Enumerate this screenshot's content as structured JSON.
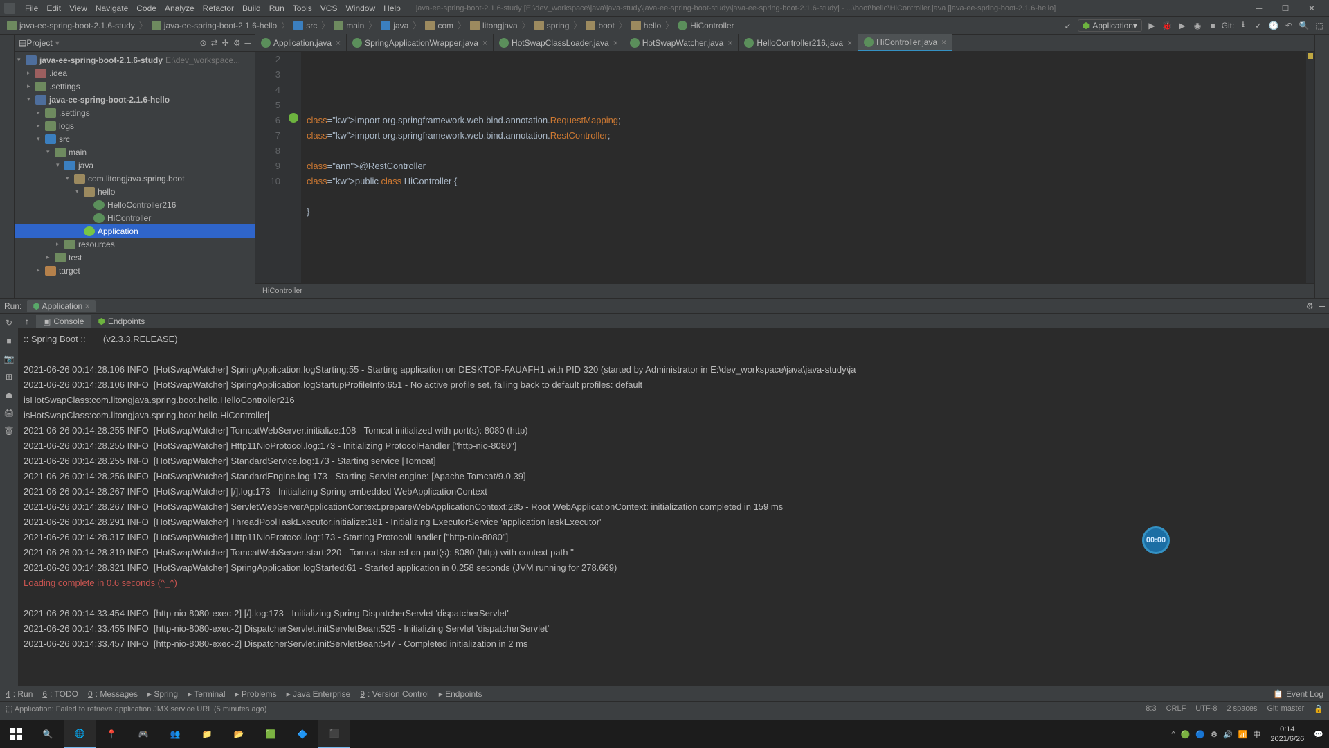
{
  "menu": [
    "File",
    "Edit",
    "View",
    "Navigate",
    "Code",
    "Analyze",
    "Refactor",
    "Build",
    "Run",
    "Tools",
    "VCS",
    "Window",
    "Help"
  ],
  "title": "java-ee-spring-boot-2.1.6-study [E:\\dev_workspace\\java\\java-study\\java-ee-spring-boot-study\\java-ee-spring-boot-2.1.6-study] - ...\\boot\\hello\\HiController.java [java-ee-spring-boot-2.1.6-hello]",
  "breadcrumbs": [
    {
      "t": "java-ee-spring-boot-2.1.6-study",
      "k": "module"
    },
    {
      "t": "java-ee-spring-boot-2.1.6-hello",
      "k": "module"
    },
    {
      "t": "src",
      "k": "src"
    },
    {
      "t": "main",
      "k": "folder"
    },
    {
      "t": "java",
      "k": "src"
    },
    {
      "t": "com",
      "k": "pkg"
    },
    {
      "t": "litongjava",
      "k": "pkg"
    },
    {
      "t": "spring",
      "k": "pkg"
    },
    {
      "t": "boot",
      "k": "pkg"
    },
    {
      "t": "hello",
      "k": "pkg"
    },
    {
      "t": "HiController",
      "k": "cls"
    }
  ],
  "runconfig": "Application",
  "git_label": "Git:",
  "project": {
    "header": "Project",
    "rootSuffix": "E:\\dev_workspace...",
    "tree": [
      {
        "d": 0,
        "a": "▾",
        "i": "module",
        "n": "java-ee-spring-boot-2.1.6-study",
        "bold": true
      },
      {
        "d": 1,
        "a": "▸",
        "i": "folder-red",
        "n": ".idea"
      },
      {
        "d": 1,
        "a": "▸",
        "i": "folder",
        "n": ".settings"
      },
      {
        "d": 1,
        "a": "▾",
        "i": "module",
        "n": "java-ee-spring-boot-2.1.6-hello",
        "bold": true
      },
      {
        "d": 2,
        "a": "▸",
        "i": "folder",
        "n": ".settings"
      },
      {
        "d": 2,
        "a": "▸",
        "i": "folder",
        "n": "logs"
      },
      {
        "d": 2,
        "a": "▾",
        "i": "folder-blue",
        "n": "src"
      },
      {
        "d": 3,
        "a": "▾",
        "i": "folder",
        "n": "main"
      },
      {
        "d": 4,
        "a": "▾",
        "i": "folder-blue",
        "n": "java"
      },
      {
        "d": 5,
        "a": "▾",
        "i": "pkg",
        "n": "com.litongjava.spring.boot"
      },
      {
        "d": 6,
        "a": "▾",
        "i": "pkg",
        "n": "hello"
      },
      {
        "d": 7,
        "a": "",
        "i": "cls",
        "n": "HelloController216"
      },
      {
        "d": 7,
        "a": "",
        "i": "cls",
        "n": "HiController"
      },
      {
        "d": 6,
        "a": "",
        "i": "spring",
        "n": "Application",
        "sel": true
      },
      {
        "d": 4,
        "a": "▸",
        "i": "folder",
        "n": "resources"
      },
      {
        "d": 3,
        "a": "▸",
        "i": "folder",
        "n": "test"
      },
      {
        "d": 2,
        "a": "▸",
        "i": "folder-orange",
        "n": "target"
      }
    ]
  },
  "tabs": [
    {
      "n": "Application.java"
    },
    {
      "n": "SpringApplicationWrapper.java"
    },
    {
      "n": "HotSwapClassLoader.java"
    },
    {
      "n": "HotSwapWatcher.java"
    },
    {
      "n": "HelloController216.java"
    },
    {
      "n": "HiController.java",
      "active": true
    }
  ],
  "editor": {
    "startLine": 2,
    "lines": [
      "",
      "import org.springframework.web.bind.annotation.RequestMapping;",
      "import org.springframework.web.bind.annotation.RestController;",
      "",
      "@RestController",
      "public class HiController {",
      "",
      "}",
      ""
    ],
    "breadcrumb": "HiController"
  },
  "run": {
    "label": "Run:",
    "tab": "Application",
    "console_tabs": [
      "Console",
      "Endpoints"
    ],
    "banner": ":: Spring Boot ::       (v2.3.3.RELEASE)",
    "lines": [
      "2021-06-26 00:14:28.106 INFO  [HotSwapWatcher] SpringApplication.logStarting:55 - Starting application on DESKTOP-FAUAFH1 with PID 320 (started by Administrator in E:\\dev_workspace\\java\\java-study\\ja",
      "2021-06-26 00:14:28.106 INFO  [HotSwapWatcher] SpringApplication.logStartupProfileInfo:651 - No active profile set, falling back to default profiles: default",
      "isHotSwapClass:com.litongjava.spring.boot.hello.HelloController216",
      "isHotSwapClass:com.litongjava.spring.boot.hello.HiController",
      "2021-06-26 00:14:28.255 INFO  [HotSwapWatcher] TomcatWebServer.initialize:108 - Tomcat initialized with port(s): 8080 (http)",
      "2021-06-26 00:14:28.255 INFO  [HotSwapWatcher] Http11NioProtocol.log:173 - Initializing ProtocolHandler [\"http-nio-8080\"]",
      "2021-06-26 00:14:28.255 INFO  [HotSwapWatcher] StandardService.log:173 - Starting service [Tomcat]",
      "2021-06-26 00:14:28.256 INFO  [HotSwapWatcher] StandardEngine.log:173 - Starting Servlet engine: [Apache Tomcat/9.0.39]",
      "2021-06-26 00:14:28.267 INFO  [HotSwapWatcher] [/].log:173 - Initializing Spring embedded WebApplicationContext",
      "2021-06-26 00:14:28.267 INFO  [HotSwapWatcher] ServletWebServerApplicationContext.prepareWebApplicationContext:285 - Root WebApplicationContext: initialization completed in 159 ms",
      "2021-06-26 00:14:28.291 INFO  [HotSwapWatcher] ThreadPoolTaskExecutor.initialize:181 - Initializing ExecutorService 'applicationTaskExecutor'",
      "2021-06-26 00:14:28.317 INFO  [HotSwapWatcher] Http11NioProtocol.log:173 - Starting ProtocolHandler [\"http-nio-8080\"]",
      "2021-06-26 00:14:28.319 INFO  [HotSwapWatcher] TomcatWebServer.start:220 - Tomcat started on port(s): 8080 (http) with context path ''",
      "2021-06-26 00:14:28.321 INFO  [HotSwapWatcher] SpringApplication.logStarted:61 - Started application in 0.258 seconds (JVM running for 278.669)"
    ],
    "loading": "Loading complete in 0.6 seconds (^_^)",
    "lines2": [
      "2021-06-26 00:14:33.454 INFO  [http-nio-8080-exec-2] [/].log:173 - Initializing Spring DispatcherServlet 'dispatcherServlet'",
      "2021-06-26 00:14:33.455 INFO  [http-nio-8080-exec-2] DispatcherServlet.initServletBean:525 - Initializing Servlet 'dispatcherServlet'",
      "2021-06-26 00:14:33.457 INFO  [http-nio-8080-exec-2] DispatcherServlet.initServletBean:547 - Completed initialization in 2 ms"
    ]
  },
  "bottom_toolwins": [
    {
      "k": "4",
      "n": "Run"
    },
    {
      "k": "6",
      "n": "TODO"
    },
    {
      "k": "0",
      "n": "Messages"
    },
    {
      "k": "",
      "n": "Spring"
    },
    {
      "k": "",
      "n": "Terminal"
    },
    {
      "k": "",
      "n": "Problems"
    },
    {
      "k": "",
      "n": "Java Enterprise"
    },
    {
      "k": "9",
      "n": "Version Control"
    },
    {
      "k": "",
      "n": "Endpoints"
    }
  ],
  "eventlog": "Event Log",
  "status_msg": "Application: Failed to retrieve application JMX service URL (5 minutes ago)",
  "status_right": [
    "8:3",
    "CRLF",
    "UTF-8",
    "2 spaces",
    "Git: master"
  ],
  "clock": {
    "time": "0:14",
    "date": "2021/6/26"
  },
  "badge": "00:00"
}
